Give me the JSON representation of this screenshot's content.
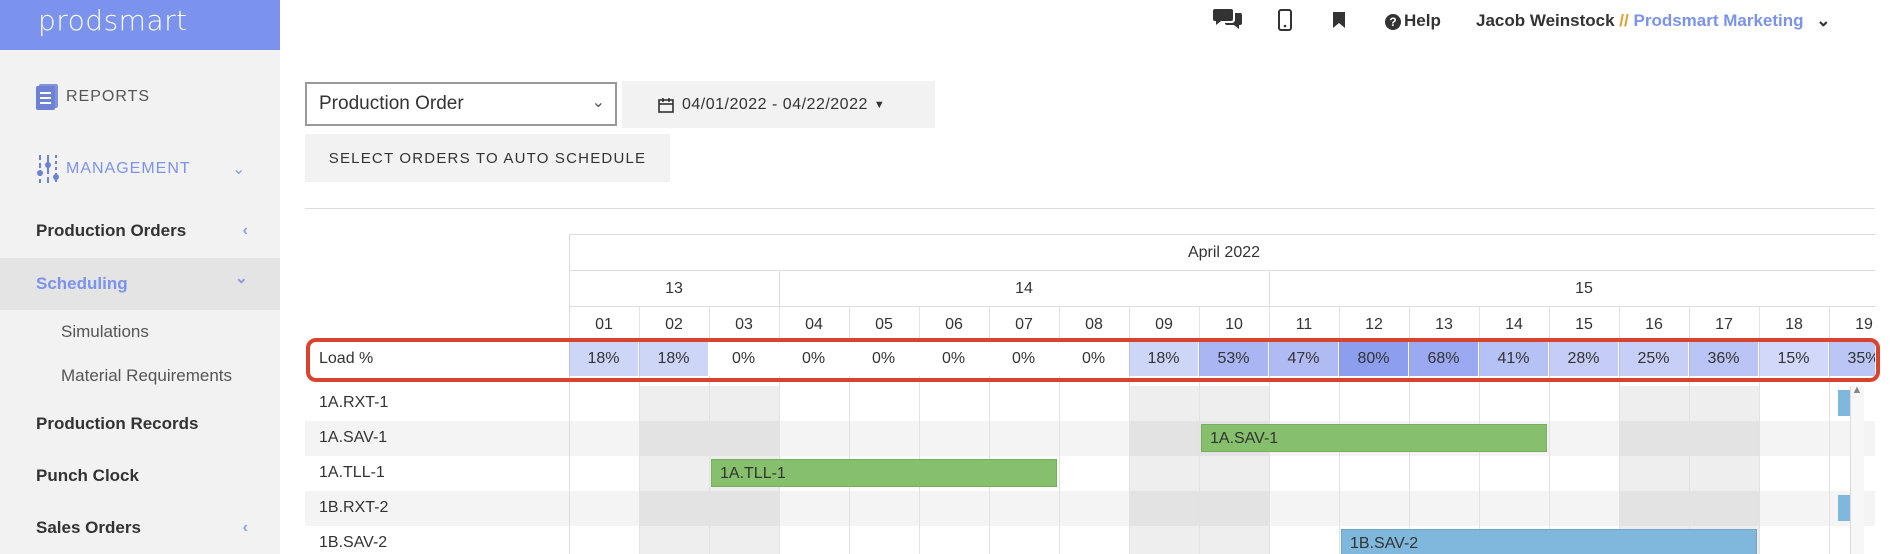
{
  "brand": "prodsmart",
  "sidebar": {
    "reports": "REPORTS",
    "management": "MANAGEMENT",
    "items": [
      {
        "label": "Production Orders",
        "chevron": "‹"
      },
      {
        "label": "Scheduling",
        "chevron": "⌄"
      },
      {
        "label": "Simulations"
      },
      {
        "label": "Material Requirements"
      },
      {
        "label": "Production Records"
      },
      {
        "label": "Punch Clock"
      },
      {
        "label": "Sales Orders",
        "chevron": "‹"
      }
    ]
  },
  "topbar": {
    "help": "Help",
    "user": "Jacob Weinstock",
    "separator": " // ",
    "org": "Prodsmart Marketing"
  },
  "controls": {
    "order_type": "Production Order",
    "date_range": "04/01/2022 - 04/22/2022",
    "auto_schedule": "SELECT ORDERS TO AUTO SCHEDULE"
  },
  "gantt": {
    "month": "April 2022",
    "weeks": [
      "13",
      "14",
      "15"
    ],
    "days": [
      "01",
      "02",
      "03",
      "04",
      "05",
      "06",
      "07",
      "08",
      "09",
      "10",
      "11",
      "12",
      "13",
      "14",
      "15",
      "16",
      "17",
      "18",
      "19"
    ],
    "load_label": "Load %",
    "load": [
      "18%",
      "18%",
      "0%",
      "0%",
      "0%",
      "0%",
      "0%",
      "0%",
      "18%",
      "53%",
      "47%",
      "80%",
      "68%",
      "41%",
      "28%",
      "25%",
      "36%",
      "15%",
      "35%"
    ],
    "load_values": [
      18,
      18,
      0,
      0,
      0,
      0,
      0,
      0,
      18,
      53,
      47,
      80,
      68,
      41,
      28,
      25,
      36,
      15,
      35
    ],
    "rows": [
      "1A.RXT-1",
      "1A.SAV-1",
      "1A.TLL-1",
      "1B.RXT-2",
      "1B.SAV-2"
    ],
    "bars": [
      {
        "row": 1,
        "label": "1A.SAV-1",
        "start_day": "10",
        "end_day": "14",
        "color": "#86c06c"
      },
      {
        "row": 2,
        "label": "1A.TLL-1",
        "start_day": "03",
        "end_day": "07",
        "color": "#86c06c"
      },
      {
        "row": 4,
        "label": "1B.SAV-2",
        "start_day": "12",
        "end_day": "17",
        "color": "#7fb8dc"
      }
    ],
    "highlight_color": "#d9432d"
  }
}
